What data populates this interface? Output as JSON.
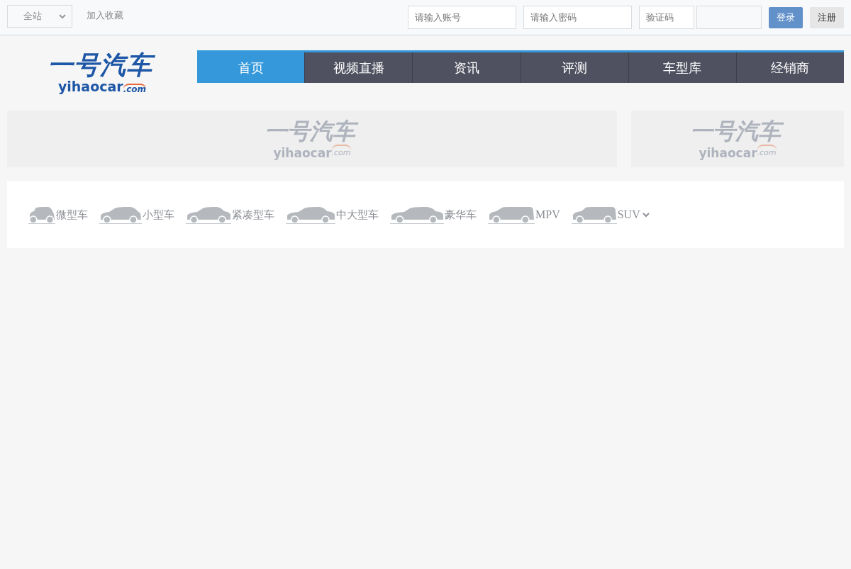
{
  "topbar": {
    "site_select": {
      "value": "全站"
    },
    "favorite_link": "加入收藏",
    "account_field": {
      "placeholder": "请输入账号"
    },
    "password_field": {
      "placeholder": "请输入密码"
    },
    "captcha_field": {
      "placeholder": "验证码"
    },
    "login_button": "登录",
    "register_button": "注册"
  },
  "logo": {
    "title": "一号汽车",
    "domain": "yihaocar",
    "suffix": ".com"
  },
  "nav": [
    {
      "label": "首页",
      "selected": true
    },
    {
      "label": "视频直播",
      "selected": false
    },
    {
      "label": "资讯",
      "selected": false
    },
    {
      "label": "评测",
      "selected": false
    },
    {
      "label": "车型库",
      "selected": false
    },
    {
      "label": "经销商",
      "selected": false
    }
  ],
  "banners": [
    {
      "title": "一号汽车",
      "domain": "yihaocar",
      "suffix": ".com"
    },
    {
      "title": "一号汽车",
      "domain": "yihaocar",
      "suffix": ".com"
    }
  ],
  "car_types": [
    {
      "label": "微型车",
      "kind": "micro",
      "dropdown": false
    },
    {
      "label": "小型车",
      "kind": "hatch",
      "dropdown": false
    },
    {
      "label": "紧凑型车",
      "kind": "compact",
      "dropdown": false
    },
    {
      "label": "中大型车",
      "kind": "sedan",
      "dropdown": false
    },
    {
      "label": "豪华车",
      "kind": "luxury",
      "dropdown": false
    },
    {
      "label": "MPV",
      "kind": "mpv",
      "dropdown": false
    },
    {
      "label": "SUV",
      "kind": "suv",
      "dropdown": true
    }
  ]
}
